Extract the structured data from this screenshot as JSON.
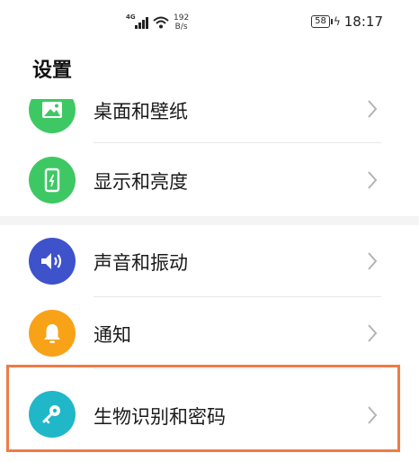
{
  "status_bar": {
    "network": "4G",
    "speed_value": "192",
    "speed_unit": "B/s",
    "battery": "58",
    "time": "18:17"
  },
  "page_title": "设置",
  "items": [
    {
      "label": "桌面和壁纸",
      "icon": "wallpaper-icon",
      "color": "#3ec864"
    },
    {
      "label": "显示和亮度",
      "icon": "display-brightness-icon",
      "color": "#3ec864"
    },
    {
      "label": "声音和振动",
      "icon": "speaker-icon",
      "color": "#3e52cc"
    },
    {
      "label": "通知",
      "icon": "bell-icon",
      "color": "#f8a218"
    },
    {
      "label": "生物识别和密码",
      "icon": "key-icon",
      "color": "#20b8c8"
    }
  ],
  "highlight_color": "#f07b47"
}
